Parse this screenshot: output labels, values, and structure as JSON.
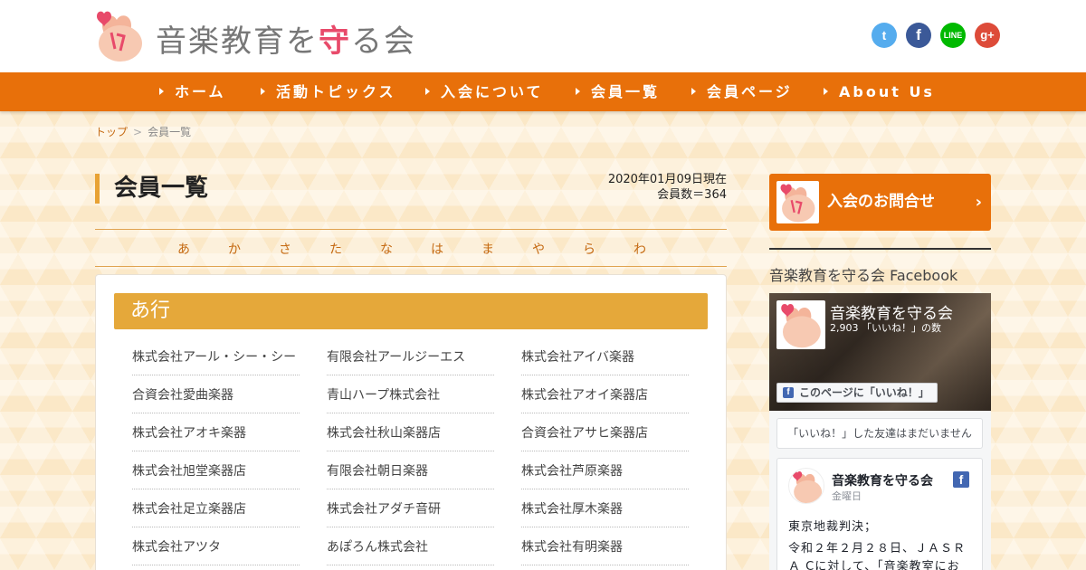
{
  "header": {
    "title_before": "音楽教育を",
    "title_accent": "守",
    "title_after": "る会",
    "social": [
      {
        "name": "twitter-icon",
        "glyph": "t"
      },
      {
        "name": "facebook-icon",
        "glyph": "f"
      },
      {
        "name": "line-icon",
        "glyph": "LINE"
      },
      {
        "name": "google-plus-icon",
        "glyph": "g+"
      }
    ]
  },
  "nav": {
    "items": [
      {
        "label": "ホーム"
      },
      {
        "label": "活動トピックス"
      },
      {
        "label": "入会について"
      },
      {
        "label": "会員一覧"
      },
      {
        "label": "会員ページ"
      },
      {
        "label": "About Us"
      }
    ]
  },
  "breadcrumb": {
    "home": "トップ",
    "separator": ">",
    "current": "会員一覧"
  },
  "main": {
    "title": "会員一覧",
    "as_of": "2020年01月09日現在",
    "member_count": "会員数＝364",
    "kana_index": [
      "あ",
      "か",
      "さ",
      "た",
      "な",
      "は",
      "ま",
      "や",
      "ら",
      "わ"
    ],
    "section_title": "あ行",
    "members": [
      "株式会社アール・シー・シー",
      "有限会社アールジーエス",
      "株式会社アイバ楽器",
      "合資会社愛曲楽器",
      "青山ハープ株式会社",
      "株式会社アオイ楽器店",
      "株式会社アオキ楽器",
      "株式会社秋山楽器店",
      "合資会社アサヒ楽器店",
      "株式会社旭堂楽器店",
      "有限会社朝日楽器",
      "株式会社芦原楽器",
      "株式会社足立楽器店",
      "株式会社アダチ音研",
      "株式会社厚木楽器",
      "株式会社アツタ",
      "あぽろん株式会社",
      "株式会社有明楽器"
    ]
  },
  "sidebar": {
    "contact_label": "入会のお問合せ",
    "contact_chevron": "›",
    "fb_heading": "音楽教育を守る会 Facebook",
    "fb_page_name": "音楽教育を守る会",
    "fb_likes": "2,903 「いいね！」の数",
    "fb_like_button": "このページに「いいね！」",
    "fb_like_glyph": "f",
    "fb_friends": "「いいね！」した友達はまだいません",
    "post": {
      "name": "音楽教育を守る会",
      "day": "金曜日",
      "icon_glyph": "f",
      "lines": [
        "東京地裁判決；",
        "令和２年２月２８日、ＪＡＳＲ",
        "Ａ Cに対して、「音楽教室にお"
      ]
    }
  },
  "colors": {
    "brand_orange": "#e8700a",
    "section_gold": "#e5a83a",
    "accent_pink": "#e84a6a"
  }
}
